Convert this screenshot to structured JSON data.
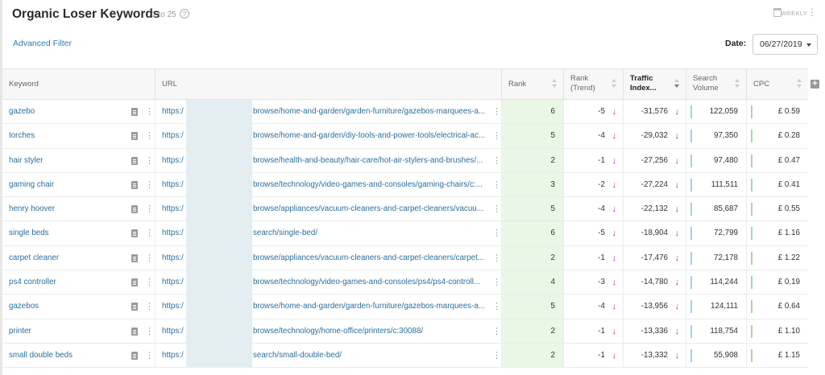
{
  "header": {
    "title": "Organic Loser Keywords",
    "range": "1 to 25",
    "help_icon": "question-circle-icon",
    "weekly_label": "WEEKLY",
    "calendar_icon": "calendar-icon",
    "menu_icon": "vertical-kebab-icon"
  },
  "filter": {
    "advanced_label": "Advanced Filter"
  },
  "date": {
    "label": "Date:",
    "value": "06/27/2019"
  },
  "columns": {
    "keyword": "Keyword",
    "url": "URL",
    "rank": "Rank",
    "rank_trend_1": "Rank",
    "rank_trend_2": "(Trend)",
    "traffic_1": "Traffic",
    "traffic_2": "Index...",
    "search_1": "Search",
    "search_2": "Volume",
    "cpc": "CPC"
  },
  "colors": {
    "link": "#2a6f9e",
    "rank_bg": "#eaf6e6",
    "down_arrow": "#d9342b"
  },
  "rows": [
    {
      "keyword": "gazebo",
      "url_prefix": "https:/",
      "url_path": "browse/home-and-garden/garden-furniture/gazebos-marquees-a...",
      "rank": "6",
      "trend": "-5",
      "traffic": "-31,576",
      "volume": "122,059",
      "cpc": "£ 0.59"
    },
    {
      "keyword": "torches",
      "url_prefix": "https:/",
      "url_path": "browse/home-and-garden/diy-tools-and-power-tools/electrical-ac...",
      "rank": "5",
      "trend": "-4",
      "traffic": "-29,032",
      "volume": "97,350",
      "cpc": "£ 0.28"
    },
    {
      "keyword": "hair styler",
      "url_prefix": "https:/",
      "url_path": "browse/health-and-beauty/hair-care/hot-air-stylers-and-brushes/...",
      "rank": "2",
      "trend": "-1",
      "traffic": "-27,256",
      "volume": "97,480",
      "cpc": "£ 0.47"
    },
    {
      "keyword": "gaming chair",
      "url_prefix": "https:/",
      "url_path": "browse/technology/video-games-and-consoles/gaming-chairs/c:...",
      "rank": "3",
      "trend": "-2",
      "traffic": "-27,224",
      "volume": "111,511",
      "cpc": "£ 0.41"
    },
    {
      "keyword": "henry hoover",
      "url_prefix": "https:/",
      "url_path": "browse/appliances/vacuum-cleaners-and-carpet-cleaners/vacuu...",
      "rank": "5",
      "trend": "-4",
      "traffic": "-22,132",
      "volume": "85,687",
      "cpc": "£ 0.55"
    },
    {
      "keyword": "single beds",
      "url_prefix": "https:/",
      "url_path": "search/single-bed/",
      "rank": "6",
      "trend": "-5",
      "traffic": "-18,904",
      "volume": "72,799",
      "cpc": "£ 1.16"
    },
    {
      "keyword": "carpet cleaner",
      "url_prefix": "https:/",
      "url_path": "browse/appliances/vacuum-cleaners-and-carpet-cleaners/carpet...",
      "rank": "2",
      "trend": "-1",
      "traffic": "-17,476",
      "volume": "72,178",
      "cpc": "£ 1.22"
    },
    {
      "keyword": "ps4 controller",
      "url_prefix": "https:/",
      "url_path": "browse/technology/video-games-and-consoles/ps4/ps4-controll...",
      "rank": "4",
      "trend": "-3",
      "traffic": "-14,780",
      "volume": "114,244",
      "cpc": "£ 0.19"
    },
    {
      "keyword": "gazebos",
      "url_prefix": "https:/",
      "url_path": "browse/home-and-garden/garden-furniture/gazebos-marquees-a...",
      "rank": "5",
      "trend": "-4",
      "traffic": "-13,956",
      "volume": "124,111",
      "cpc": "£ 0.64"
    },
    {
      "keyword": "printer",
      "url_prefix": "https:/",
      "url_path": "browse/technology/home-office/printers/c:30088/",
      "rank": "2",
      "trend": "-1",
      "traffic": "-13,336",
      "volume": "118,754",
      "cpc": "£ 1.10"
    },
    {
      "keyword": "small double beds",
      "url_prefix": "https:/",
      "url_path": "search/small-double-bed/",
      "rank": "2",
      "trend": "-1",
      "traffic": "-13,332",
      "volume": "55,908",
      "cpc": "£ 1.15"
    }
  ]
}
